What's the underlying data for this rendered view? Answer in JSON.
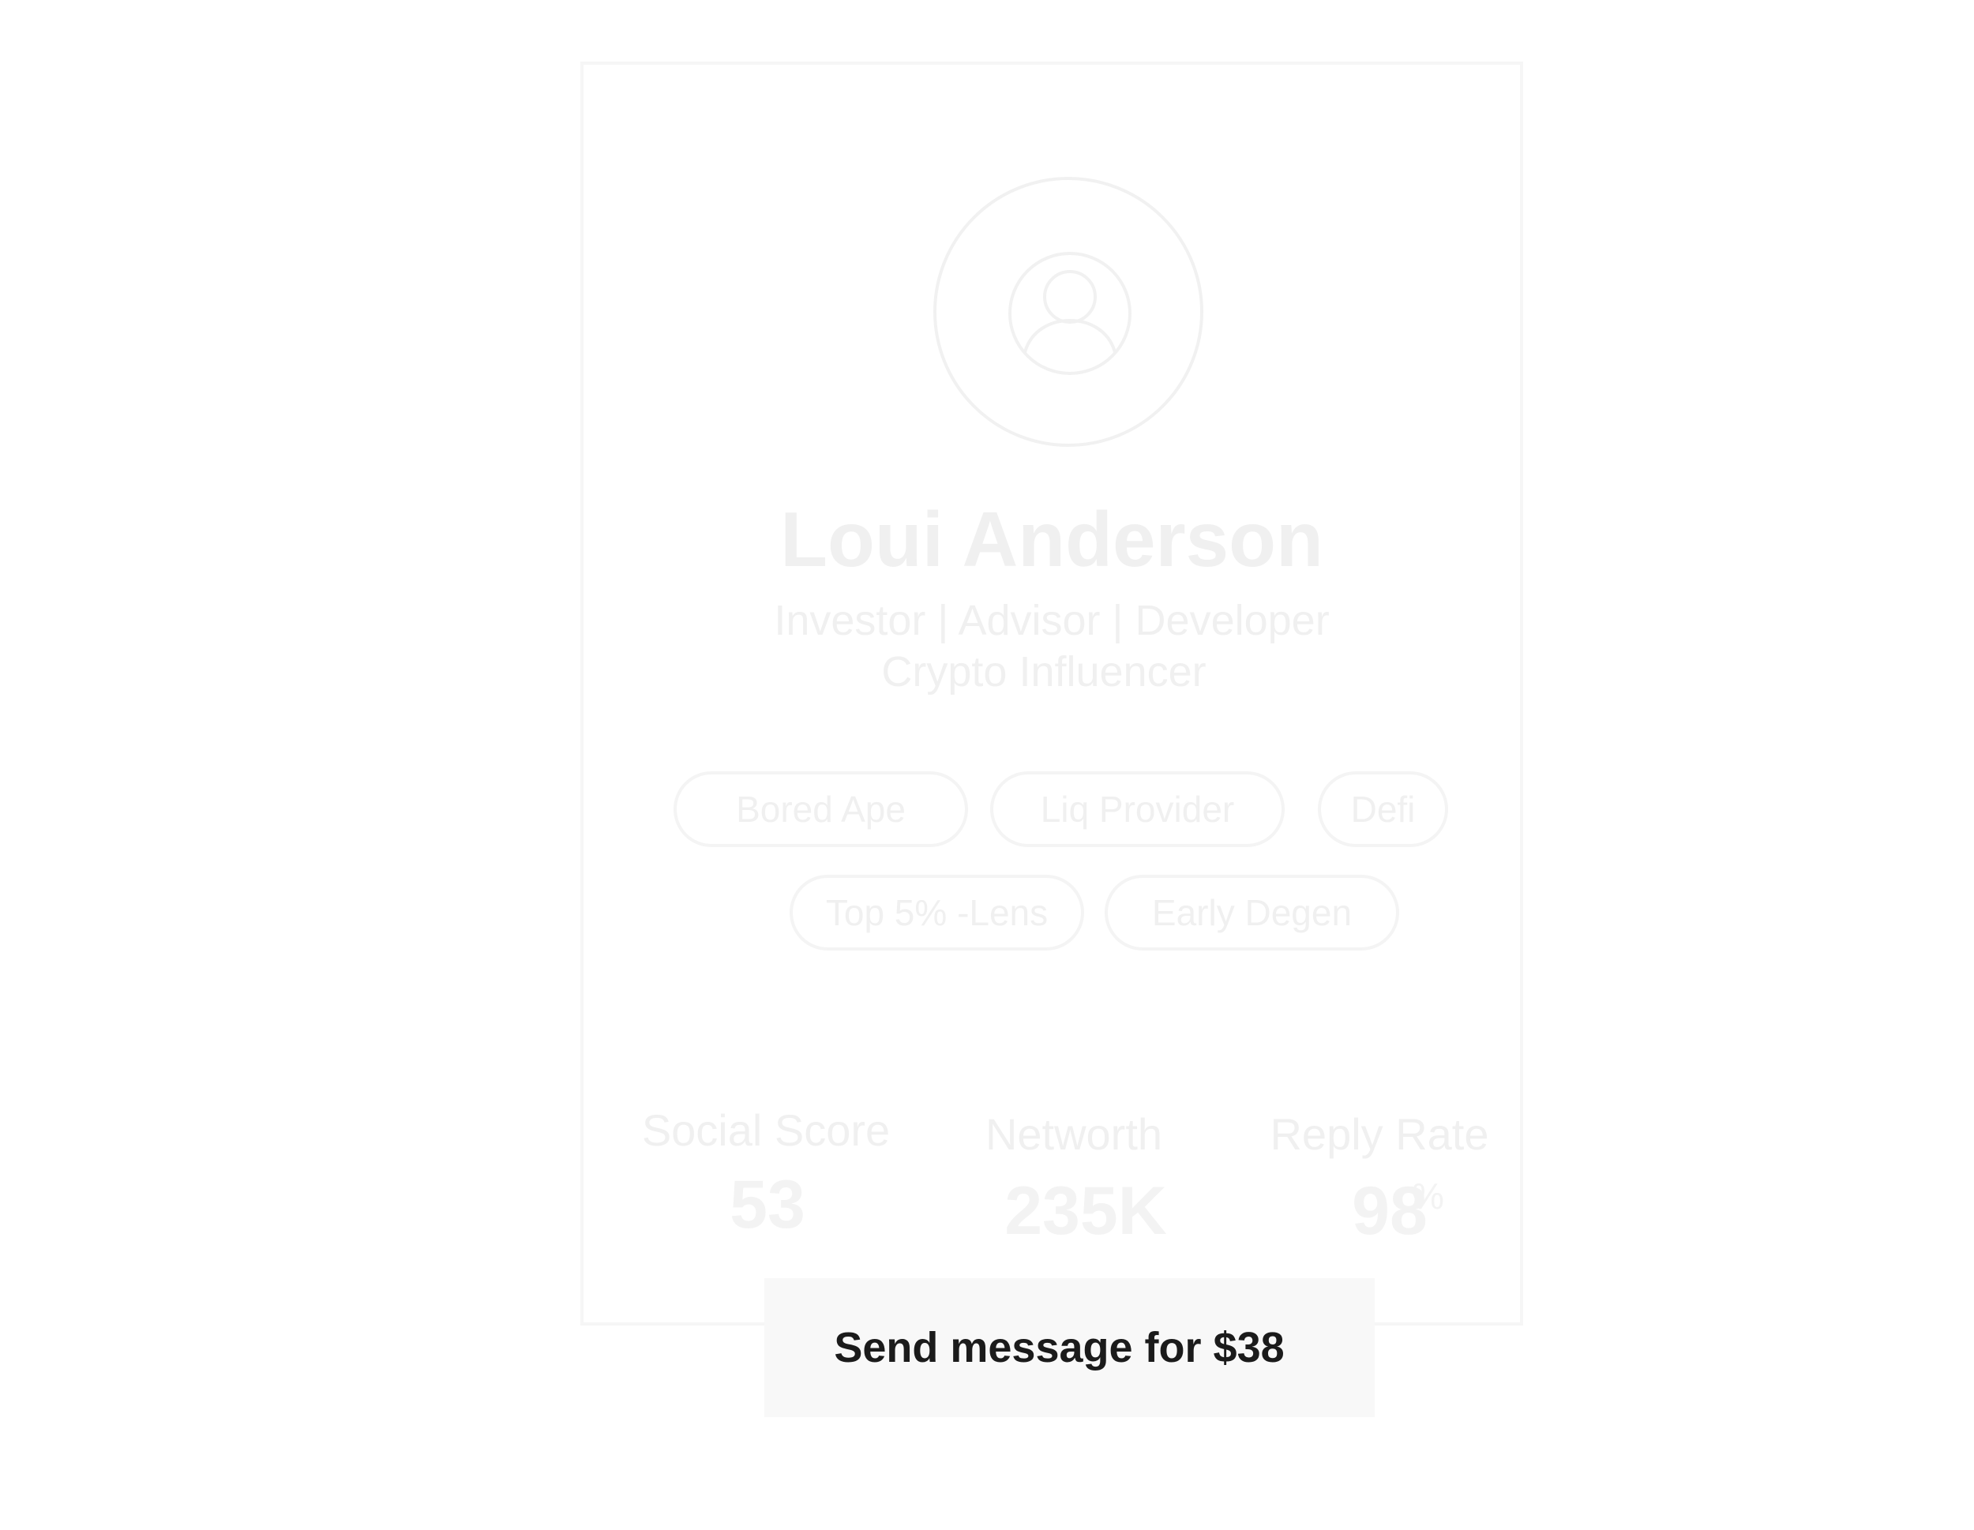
{
  "profile": {
    "name": "Loui Anderson",
    "bio_line_1": "Investor | Advisor  | Developer",
    "bio_line_2": "Crypto Influencer",
    "avatar_icon": "user-icon"
  },
  "tags": [
    {
      "label": "Bored Ape"
    },
    {
      "label": "Liq Provider"
    },
    {
      "label": "Defi"
    },
    {
      "label": "Top 5% -Lens"
    },
    {
      "label": "Early Degen"
    }
  ],
  "stats": {
    "social_score": {
      "label": "Social Score",
      "value": "53"
    },
    "networth": {
      "label": "Networth",
      "value": "235K"
    },
    "reply_rate": {
      "label": "Reply Rate",
      "value": "98",
      "unit": "%"
    }
  },
  "action": {
    "send_label": "Send message for $38"
  },
  "colors": {
    "button_bg": "#f8f8f8",
    "button_text": "#1b1b1b",
    "faded_text": "#f0f0f0",
    "card_border": "#f6f6f6"
  }
}
